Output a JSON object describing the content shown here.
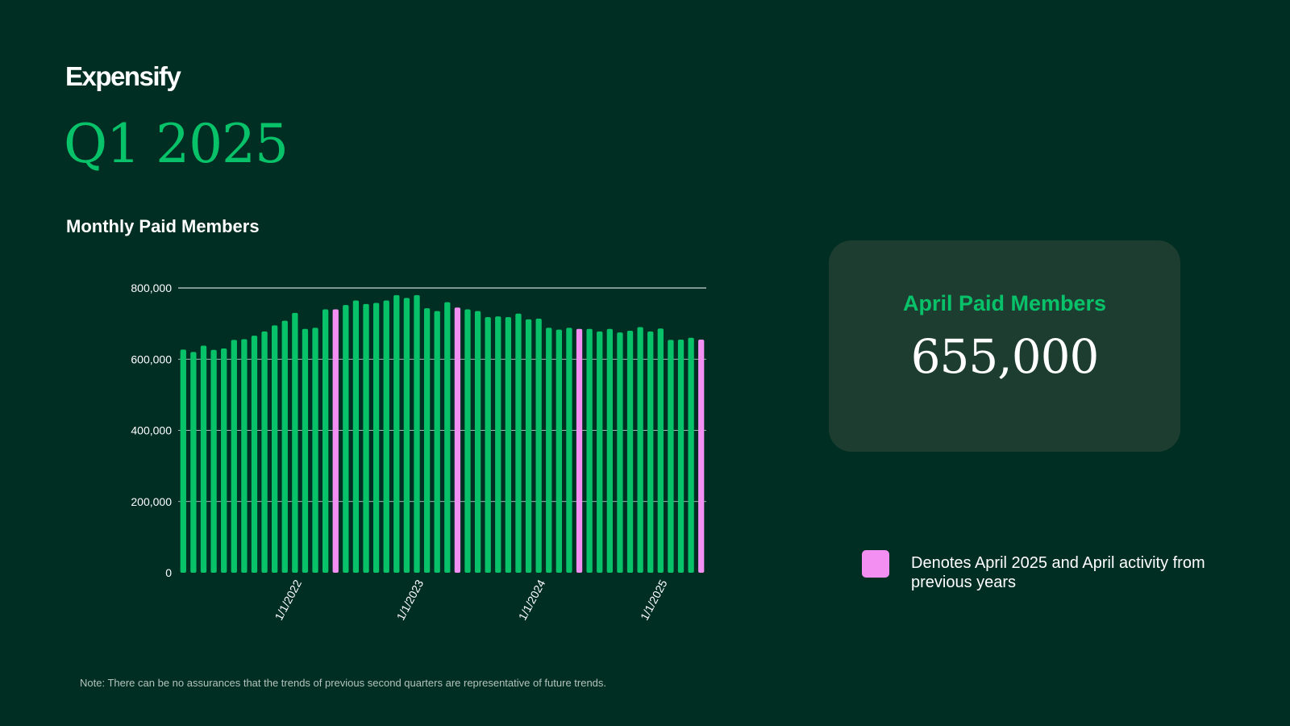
{
  "brand": {
    "logo_text": "Expensify",
    "period": "Q1 2025"
  },
  "colors": {
    "background": "#002E22",
    "bar_default": "#08C26A",
    "bar_highlight": "#F38EF2",
    "card_background": "#1E3D31",
    "accent_text": "#08C26A"
  },
  "chart_data": {
    "type": "bar",
    "title": "Monthly Paid Members",
    "xlabel": "",
    "ylabel": "",
    "ylim": [
      0,
      800000
    ],
    "yticks": [
      "0",
      "200,000",
      "400,000",
      "600,000",
      "800,000"
    ],
    "ytick_values": [
      0,
      200000,
      400000,
      600000,
      800000
    ],
    "grid": true,
    "x_ticks": [
      {
        "index": 12,
        "label": "1/1/2022"
      },
      {
        "index": 24,
        "label": "1/1/2023"
      },
      {
        "index": 36,
        "label": "1/1/2024"
      },
      {
        "index": 48,
        "label": "1/1/2025"
      }
    ],
    "categories": [
      "2021-01",
      "2021-02",
      "2021-03",
      "2021-04",
      "2021-05",
      "2021-06",
      "2021-07",
      "2021-08",
      "2021-09",
      "2021-10",
      "2021-11",
      "2021-12",
      "2022-01",
      "2022-02",
      "2022-03",
      "2022-04",
      "2022-05",
      "2022-06",
      "2022-07",
      "2022-08",
      "2022-09",
      "2022-10",
      "2022-11",
      "2022-12",
      "2023-01",
      "2023-02",
      "2023-03",
      "2023-04",
      "2023-05",
      "2023-06",
      "2023-07",
      "2023-08",
      "2023-09",
      "2023-10",
      "2023-11",
      "2023-12",
      "2024-01",
      "2024-02",
      "2024-03",
      "2024-04",
      "2024-05",
      "2024-06",
      "2024-07",
      "2024-08",
      "2024-09",
      "2024-10",
      "2024-11",
      "2024-12",
      "2025-01",
      "2025-02",
      "2025-03",
      "2025-04"
    ],
    "values": [
      627000,
      620000,
      638000,
      626000,
      630000,
      654000,
      656000,
      666000,
      678000,
      695000,
      708000,
      730000,
      685000,
      688000,
      740000,
      740000,
      752000,
      765000,
      755000,
      758000,
      765000,
      780000,
      772000,
      780000,
      743000,
      735000,
      760000,
      745000,
      740000,
      735000,
      718000,
      720000,
      718000,
      728000,
      712000,
      714000,
      688000,
      683000,
      688000,
      685000,
      685000,
      678000,
      685000,
      675000,
      680000,
      690000,
      678000,
      686000,
      654000,
      655000,
      660000,
      655000
    ],
    "highlight_indices": [
      15,
      27,
      39,
      51
    ],
    "legend": {
      "text": "Denotes April 2025 and April activity from previous years",
      "color": "#F38EF2"
    }
  },
  "card": {
    "label": "April Paid Members",
    "value": "655,000"
  },
  "note": "Note: There can be no assurances that the trends of previous second quarters are representative of future trends."
}
